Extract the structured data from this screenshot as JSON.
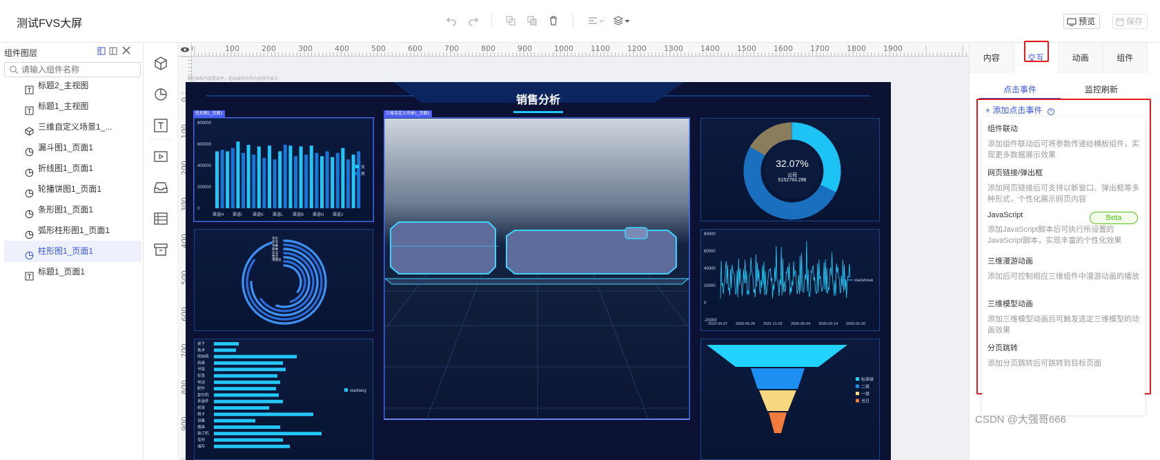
{
  "header": {
    "title": "测试FVS大屏",
    "preview_label": "预览",
    "save_label": "保存"
  },
  "layers": {
    "title": "组件图层",
    "search_placeholder": "请输入组件名称",
    "items": [
      {
        "label": "标题2_主视图",
        "icon": "title-icon"
      },
      {
        "label": "标题1_主视图",
        "icon": "title-icon"
      },
      {
        "label": "三维自定义场景1_...",
        "icon": "cube-icon"
      },
      {
        "label": "漏斗图1_页面1",
        "icon": "chart-icon"
      },
      {
        "label": "折线图1_页面1",
        "icon": "chart-icon"
      },
      {
        "label": "轮播饼图1_页面1",
        "icon": "chart-icon"
      },
      {
        "label": "条形图1_页面1",
        "icon": "chart-icon"
      },
      {
        "label": "弧形柱形图1_页面1",
        "icon": "chart-icon"
      },
      {
        "label": "柱形图1_页面1",
        "icon": "chart-icon",
        "active": true
      },
      {
        "label": "标题1_页面1",
        "icon": "title-icon"
      }
    ]
  },
  "ruler": {
    "top_labels": [
      "0",
      "100",
      "200",
      "300",
      "400",
      "500",
      "600",
      "700",
      "800",
      "900",
      "1000",
      "1100",
      "1200",
      "1300",
      "1400",
      "1500",
      "1600",
      "1700",
      "1800",
      "1900"
    ],
    "left_labels": [
      "0",
      "100",
      "200",
      "300",
      "400",
      "500",
      "600",
      "700",
      "800",
      "900"
    ]
  },
  "canvas": {
    "hint": "请在画布内放置组件，超出画布外的内容将不显示",
    "screen_title": "销售分析",
    "bar_chart": {
      "tag": "柱形图1_页面1",
      "y_ticks": [
        "800000",
        "600000",
        "400000",
        "200000",
        "0"
      ],
      "x_ticks": [
        "渠道H",
        "渠道I",
        "渠道K",
        "渠道L",
        "渠道B",
        "渠道N",
        "渠道J"
      ],
      "legend": [
        "女",
        "男"
      ]
    },
    "scene_tag": "三维自定义场景1_页面1",
    "donut": {
      "percent": "32.07%",
      "label": "公司",
      "value": "5152793.296"
    },
    "radial_labels": [
      "华东",
      "华北",
      "华南",
      "西南",
      "东北",
      "西北",
      "港澳台"
    ],
    "line_chart": {
      "y_ticks": [
        "80000",
        "60000",
        "40000",
        "20000",
        "0",
        "-20000"
      ],
      "x_ticks": [
        "2022-04-27",
        "2020-06-26",
        "2021-11-02",
        "2020-05-04",
        "2020-02-14",
        "2020-02-20"
      ],
      "legend": "xiaoshoue"
    },
    "hbar": {
      "labels": [
        "桌子",
        "美术",
        "收纳具",
        "用具",
        "书架",
        "标签",
        "电话",
        "配件",
        "复印机",
        "系固件",
        "纸张",
        "椅子",
        "设备",
        "器具",
        "装订机",
        "信封",
        "储存"
      ],
      "legend": "xiaoliang"
    },
    "funnel_legend": [
      "标准级",
      "二级",
      "一级",
      "当日"
    ]
  },
  "right_panel": {
    "tabs": [
      "内容",
      "交互",
      "动画",
      "组件"
    ],
    "subtabs": [
      "点击事件",
      "监控刷新"
    ],
    "add_event": "添加点击事件",
    "events": [
      {
        "title": "组件联动",
        "desc": "添加组件联动后可将参数传递给横板组件，实现更多数据展示效果"
      },
      {
        "title": "网页链接/弹出框",
        "desc": "添加网页链接后可支持以新窗口、弹出框等多种形式，个性化展示网页内容"
      },
      {
        "title": "JavaScript",
        "desc": "添加JavaScript脚本后可执行所设置的JavaScript脚本，实现丰富的个性化效果",
        "badge": "Beta"
      },
      {
        "title": "三维漫游动画",
        "desc": "添加后可控制相应三维组件中漫游动画的播放"
      },
      {
        "title": "三维模型动画",
        "desc": "添加三维模型动画后可触发选定三维模型的动画效果"
      },
      {
        "title": "分页跳转",
        "desc": "添加分页跳转后可跳转到目标页面"
      }
    ]
  },
  "watermark": "CSDN @大强哥666"
}
